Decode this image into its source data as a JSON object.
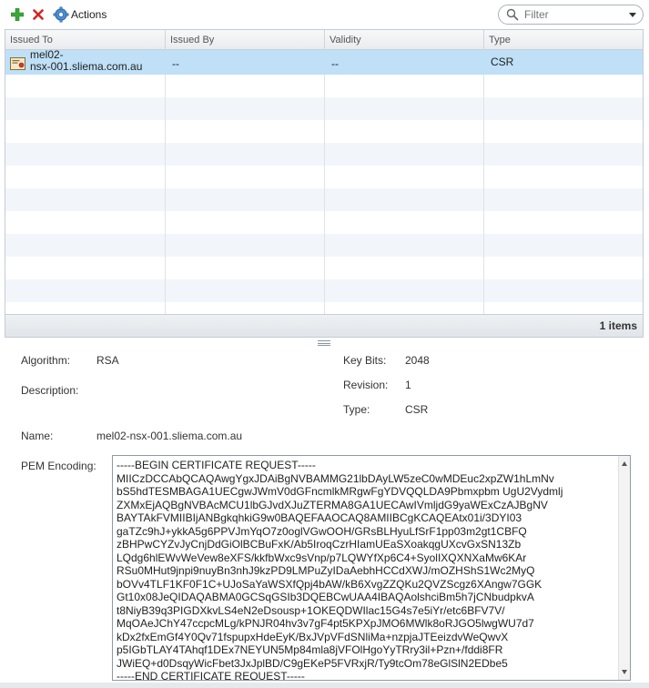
{
  "toolbar": {
    "actions_label": "Actions",
    "filter_placeholder": "Filter",
    "icons": [
      "plus-icon",
      "delete-icon",
      "gear-icon",
      "search-icon"
    ]
  },
  "grid": {
    "columns": [
      "Issued To",
      "Issued By",
      "Validity",
      "Type"
    ],
    "rows": [
      {
        "issued_to_line1": "mel02-",
        "issued_to_line2": "nsx-001.sliema.com.au",
        "issued_by": "--",
        "validity": "--",
        "type": "CSR"
      }
    ],
    "count_label": "1 items"
  },
  "details": {
    "algorithm_label": "Algorithm:",
    "algorithm_value": "RSA",
    "description_label": "Description:",
    "name_label": "Name:",
    "name_value": "mel02-nsx-001.sliema.com.au",
    "keybits_label": "Key Bits:",
    "keybits_value": "2048",
    "revision_label": "Revision:",
    "revision_value": "1",
    "type_label": "Type:",
    "type_value": "CSR",
    "pem_label": "PEM Encoding:",
    "pem_text": "-----BEGIN CERTIFICATE REQUEST-----\nMIICzDCCAbQCAQAwgYgxJDAiBgNVBAMMG21lbDAyLW5zeC0wMDEuc2xpZW1hLmNv\nbS5hdTESMBAGA1UECgwJWmV0dGFncmlkMRgwFgYDVQQLDA9Pbmxpbm UgU2Vydmlj\nZXMxEjAQBgNVBAcMCU1lbGJvdXJuZTERMA8GA1UECAwIVmljdG9yaWExCzAJBgNV\nBAYTAkFVMIIBIjANBgkqhkiG9w0BAQEFAAOCAQ8AMIIBCgKCAQEAtx01i/3DYI03\ngaTZc9hJ+ykkA5g6PPVJmYqO7z0oglVGwOOH/GRsBLHyuLfSrF1pp03m2gt1CBFQ\nzBHPwCYZvJyCnjDdGiOlBCBuFxK/Ab5IroqCzrHIamUEaSXoakqgUXcvGxSN13Zb\nLQdg6hlEWvWeVew8eXFS/kkfbWxc9sVnp/p7LQWYfXp6C4+SyolIXQXNXaMw6KAr\nRSu0MHut9jnpi9nuyBn3nhJ9kzPD9LMPuZyIDaAebhHCCdXWJ/mOZHShS1Wc2MyQ\nbOVv4TLF1KF0F1C+UJoSaYaWSXfQpj4bAW/kB6XvgZZQKu2QVZScgz6XAngw7GGK\nGt10x08JeQIDAQABMA0GCSqGSIb3DQEBCwUAA4IBAQAolshciBm5h7jCNbudpkvA\nt8NiyB39q3PIGDXkvLS4eN2eDsousp+1OKEQDWIlac15G4s7e5iYr/etc6BFV7V/\nMqOAeJChY47ccpcMLg/kPNJR04hv3v7gF4pt5KPXpJMO6MWlk8oRJGO5lwgWU7d7\nkDx2fxEmGf4Y0Qv71fspupxHdeEyK/BxJVpVFdSNliMa+nzpjaJTEeizdvWeQwvX\np5IGbTLAY4TAhqf1DEx7NEYUN5Mp84mla8jVFOlHgoYyTRry3il+Pzn+/fddi8FR\nJWiEQ+d0DsqyWicFbet3JxJplBD/C9gEKeP5FVRxjR/Ty9tcOm78eGlSlN2EDbe5\n-----END CERTIFICATE REQUEST-----"
  }
}
